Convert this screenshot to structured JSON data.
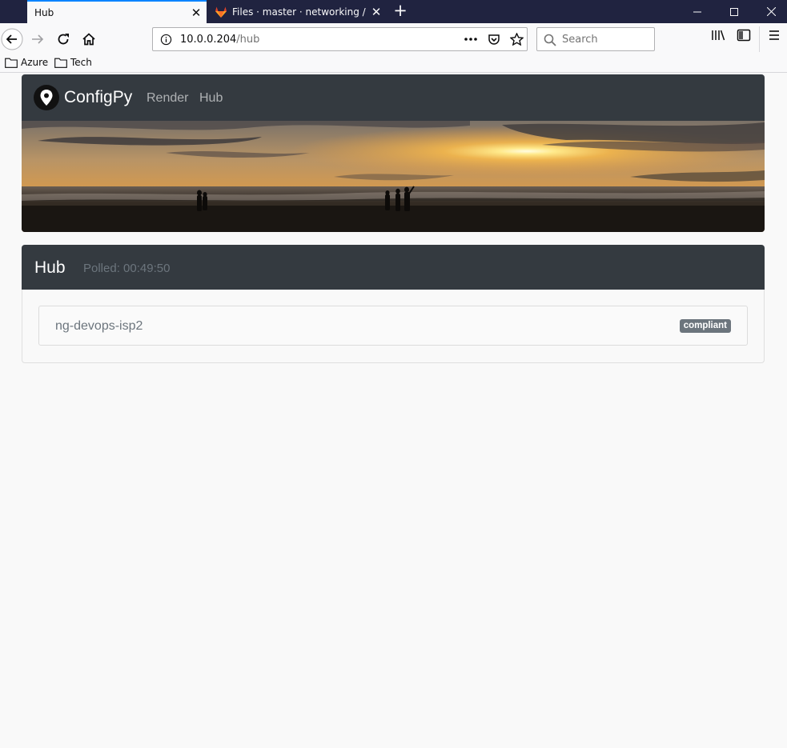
{
  "browser": {
    "tabs": [
      {
        "label": "Hub",
        "active": true
      },
      {
        "label": "Files · master · networking / co",
        "active": false
      }
    ],
    "url": {
      "host": "10.0.0.204",
      "path": "/hub"
    },
    "search_placeholder": "Search",
    "bookmarks": [
      {
        "label": "Azure"
      },
      {
        "label": "Tech"
      }
    ],
    "accent_color": "#0a84ff",
    "tabstrip_color": "#202340"
  },
  "site": {
    "brand": "ConfigPy",
    "nav": [
      {
        "label": "Render"
      },
      {
        "label": "Hub"
      }
    ],
    "header_color": "#343a40"
  },
  "hub": {
    "title": "Hub",
    "polled": "Polled: 00:49:50",
    "items": [
      {
        "name": "ng-devops-isp2",
        "status": "compliant"
      }
    ]
  }
}
